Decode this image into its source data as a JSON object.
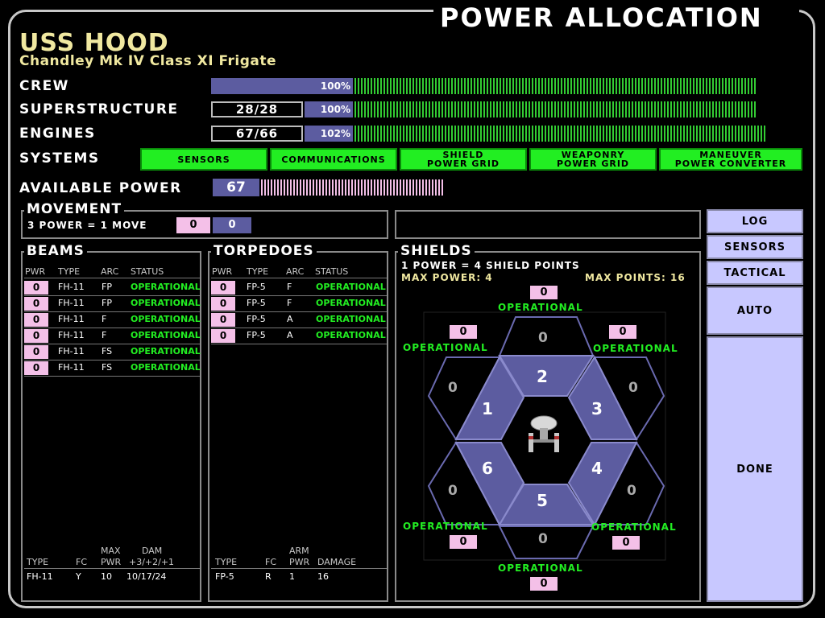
{
  "title": "POWER ALLOCATION",
  "ship": {
    "name": "USS HOOD",
    "class": "Chandley Mk IV Class XI Frigate"
  },
  "stats": {
    "crew": {
      "label": "CREW",
      "pct": "100%"
    },
    "superstructure": {
      "label": "SUPERSTRUCTURE",
      "value": "28/28",
      "pct": "100%"
    },
    "engines": {
      "label": "ENGINES",
      "value": "67/66",
      "pct": "102%"
    }
  },
  "systems": {
    "label": "SYSTEMS",
    "buttons": [
      {
        "line1": "SENSORS",
        "line2": ""
      },
      {
        "line1": "COMMUNICATIONS",
        "line2": ""
      },
      {
        "line1": "SHIELD",
        "line2": "POWER GRID"
      },
      {
        "line1": "WEAPONRY",
        "line2": "POWER GRID"
      },
      {
        "line1": "MANEUVER",
        "line2": "POWER CONVERTER"
      }
    ]
  },
  "available_power": {
    "label": "AVAILABLE POWER",
    "value": "67"
  },
  "movement": {
    "title": "MOVEMENT",
    "rate": "3 POWER = 1 MOVE",
    "power": "0",
    "moves": "0"
  },
  "beams": {
    "title": "BEAMS",
    "headers": [
      "PWR",
      "TYPE",
      "ARC",
      "STATUS"
    ],
    "rows": [
      {
        "pwr": "0",
        "type": "FH-11",
        "arc": "FP",
        "status": "OPERATIONAL"
      },
      {
        "pwr": "0",
        "type": "FH-11",
        "arc": "FP",
        "status": "OPERATIONAL"
      },
      {
        "pwr": "0",
        "type": "FH-11",
        "arc": "F",
        "status": "OPERATIONAL"
      },
      {
        "pwr": "0",
        "type": "FH-11",
        "arc": "F",
        "status": "OPERATIONAL"
      },
      {
        "pwr": "0",
        "type": "FH-11",
        "arc": "FS",
        "status": "OPERATIONAL"
      },
      {
        "pwr": "0",
        "type": "FH-11",
        "arc": "FS",
        "status": "OPERATIONAL"
      }
    ],
    "footer_headers": {
      "type": "TYPE",
      "fc": "FC",
      "maxpwr1": "MAX",
      "maxpwr2": "PWR",
      "dam1": "DAM",
      "dam2": "+3/+2/+1"
    },
    "footer": {
      "type": "FH-11",
      "fc": "Y",
      "maxpwr": "10",
      "dam": "10/17/24"
    }
  },
  "torpedoes": {
    "title": "TORPEDOES",
    "headers": [
      "PWR",
      "TYPE",
      "ARC",
      "STATUS"
    ],
    "rows": [
      {
        "pwr": "0",
        "type": "FP-5",
        "arc": "F",
        "status": "OPERATIONAL"
      },
      {
        "pwr": "0",
        "type": "FP-5",
        "arc": "F",
        "status": "OPERATIONAL"
      },
      {
        "pwr": "0",
        "type": "FP-5",
        "arc": "A",
        "status": "OPERATIONAL"
      },
      {
        "pwr": "0",
        "type": "FP-5",
        "arc": "A",
        "status": "OPERATIONAL"
      }
    ],
    "footer_headers": {
      "type": "TYPE",
      "fc": "FC",
      "armpwr1": "ARM",
      "armpwr2": "PWR",
      "damage": "DAMAGE"
    },
    "footer": {
      "type": "FP-5",
      "fc": "R",
      "armpwr": "1",
      "damage": "16"
    }
  },
  "shields": {
    "title": "SHIELDS",
    "rate": "1 POWER = 4 SHIELD POINTS",
    "max_power": "MAX POWER: 4",
    "max_points": "MAX POINTS: 16",
    "status": "OPERATIONAL",
    "sectors": [
      {
        "num": "1",
        "points": "0",
        "power": "0"
      },
      {
        "num": "2",
        "points": "0",
        "power": "0"
      },
      {
        "num": "3",
        "points": "0",
        "power": "0"
      },
      {
        "num": "4",
        "points": "0",
        "power": "0"
      },
      {
        "num": "5",
        "points": "0",
        "power": "0"
      },
      {
        "num": "6",
        "points": "0",
        "power": "0"
      }
    ]
  },
  "side": {
    "log": "LOG",
    "sensors": "SENSORS",
    "tactical": "TACTICAL",
    "auto": "AUTO",
    "done": "DONE"
  },
  "colors": {
    "accent": "#5c5ca0",
    "ok": "#22ee22",
    "pink": "#f4c0e8",
    "side": "#c8c8ff"
  }
}
